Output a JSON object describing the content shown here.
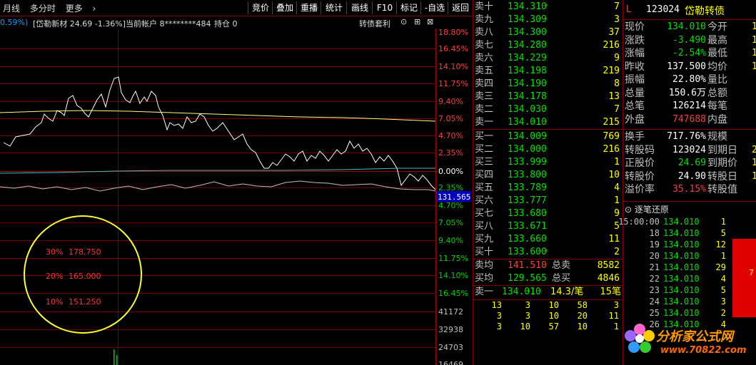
{
  "toolbar": {
    "left": [
      "月线",
      "多分时",
      "更多"
    ],
    "buttons": [
      "竞价",
      "叠加",
      "重播",
      "统计",
      "画线",
      "F10",
      "标记",
      "-自选",
      "返回"
    ]
  },
  "info": {
    "pct": "0.59%)",
    "stock": "[岱勒新材 24.69 -1.36%]",
    "account": "当前帐户 8********484",
    "position": "持仓 0",
    "arb": "转债套利"
  },
  "chart_data": {
    "type": "line",
    "y_axis_right_top": [
      "18.80%",
      "16.45%",
      "14.10%",
      "11.75%",
      "9.40%",
      "7.05%",
      "4.70%",
      "2.35%",
      "0.00%",
      "2.35%"
    ],
    "y_axis_right_bottom": [
      "4.70%",
      "7.05%",
      "9.40%",
      "11.75%",
      "14.10%",
      "16.45%"
    ],
    "current_price_label": "131.565",
    "volume_axis": [
      "41172",
      "32938",
      "24703",
      "16469"
    ],
    "annotations": [
      {
        "pct": "30%",
        "value": "178.750"
      },
      {
        "pct": "20%",
        "value": "165.000"
      },
      {
        "pct": "10%",
        "value": "151.250"
      }
    ]
  },
  "orderbook": {
    "asks": [
      {
        "label": "卖十",
        "price": "134.310",
        "mark": "*",
        "vol": "7"
      },
      {
        "label": "卖九",
        "price": "134.309",
        "mark": "",
        "vol": "3"
      },
      {
        "label": "卖八",
        "price": "134.300",
        "mark": "",
        "vol": "37"
      },
      {
        "label": "卖七",
        "price": "134.280",
        "mark": "",
        "vol": "216"
      },
      {
        "label": "卖六",
        "price": "134.229",
        "mark": "",
        "vol": "9"
      },
      {
        "label": "卖五",
        "price": "134.198",
        "mark": "",
        "vol": "219"
      },
      {
        "label": "卖四",
        "price": "134.190",
        "mark": "",
        "vol": "8"
      },
      {
        "label": "卖三",
        "price": "134.178",
        "mark": "",
        "vol": "13"
      },
      {
        "label": "卖二",
        "price": "134.030",
        "mark": "",
        "vol": "7"
      },
      {
        "label": "卖一",
        "price": "134.010",
        "mark": "",
        "vol": "215"
      }
    ],
    "bids": [
      {
        "label": "买一",
        "price": "134.009",
        "mark": "",
        "vol": "769"
      },
      {
        "label": "买二",
        "price": "134.000",
        "mark": "",
        "vol": "216"
      },
      {
        "label": "买三",
        "price": "133.999",
        "mark": "",
        "vol": "1"
      },
      {
        "label": "买四",
        "price": "133.800",
        "mark": "",
        "vol": "10"
      },
      {
        "label": "买五",
        "price": "133.789",
        "mark": "",
        "vol": "4"
      },
      {
        "label": "买六",
        "price": "133.777",
        "mark": "",
        "vol": "1"
      },
      {
        "label": "买七",
        "price": "133.680",
        "mark": "",
        "vol": "9"
      },
      {
        "label": "买八",
        "price": "133.671",
        "mark": "",
        "vol": "5"
      },
      {
        "label": "买九",
        "price": "133.660",
        "mark": "",
        "vol": "11"
      },
      {
        "label": "买十",
        "price": "133.600",
        "mark": "*",
        "vol": "2"
      }
    ],
    "summary": [
      {
        "l1": "卖均",
        "v1": "141.510",
        "l2": "总卖",
        "v2": "8582"
      },
      {
        "l1": "买均",
        "v1": "129.565",
        "l2": "总买",
        "v2": "4846"
      }
    ],
    "last": {
      "label": "卖一",
      "price": "134.010",
      "amt": "14.3/笔",
      "count": "15笔"
    },
    "ticks": [
      [
        "13",
        "3",
        "10",
        "58",
        "3"
      ],
      [
        "3",
        "3",
        "10",
        "20",
        "11"
      ],
      [
        "3",
        "10",
        "57",
        "10",
        "1"
      ]
    ]
  },
  "quote": {
    "flag": "L",
    "code": "123024",
    "name": "岱勒转债",
    "rows": [
      {
        "l": "现价",
        "v": "134.010",
        "c": "green",
        "l2": "今开",
        "v2": "1"
      },
      {
        "l": "涨跌",
        "v": "-3.490",
        "c": "green",
        "l2": "最高",
        "v2": "1"
      },
      {
        "l": "涨幅",
        "v": "-2.54%",
        "c": "green",
        "l2": "最低",
        "v2": "1"
      },
      {
        "l": "昨收",
        "v": "137.500",
        "c": "white",
        "l2": "均价",
        "v2": "1"
      },
      {
        "l": "振幅",
        "v": "22.80%",
        "c": "white",
        "l2": "量比",
        "v2": ""
      },
      {
        "l": "总量",
        "v": "150.6万",
        "c": "white",
        "l2": "总额",
        "v2": ""
      },
      {
        "l": "总笔",
        "v": "126214",
        "c": "white",
        "l2": "每笔",
        "v2": ""
      },
      {
        "l": "外盘",
        "v": "747688",
        "c": "red",
        "l2": "内盘",
        "v2": ""
      }
    ],
    "rows2": [
      {
        "l": "换手",
        "v": "717.76%",
        "c": "white",
        "l2": "规模",
        "v2": ""
      },
      {
        "l": "转股码",
        "v": "123024",
        "c": "white",
        "l2": "到期日",
        "v2": "2"
      },
      {
        "l": "正股价",
        "v": "24.69",
        "c": "green",
        "l2": "到期价",
        "v2": "1"
      },
      {
        "l": "转股价",
        "v": "24.90",
        "c": "white",
        "l2": "转股日",
        "v2": "1"
      },
      {
        "l": "溢价率",
        "v": "35.15%",
        "c": "red",
        "l2": "转股值",
        "v2": ""
      }
    ],
    "restore_title": "逐笔还原",
    "trades": [
      {
        "t": "15:00:00",
        "p": "134.010",
        "v": "1"
      },
      {
        "t": "18",
        "p": "134.010",
        "v": "5"
      },
      {
        "t": "19",
        "p": "134.010",
        "v": "12"
      },
      {
        "t": "20",
        "p": "134.010",
        "v": "1"
      },
      {
        "t": "21",
        "p": "134.010",
        "v": "29"
      },
      {
        "t": "22",
        "p": "134.010",
        "v": "4"
      },
      {
        "t": "23",
        "p": "134.010",
        "v": "5"
      },
      {
        "t": "24",
        "p": "134.010",
        "v": "3"
      },
      {
        "t": "25",
        "p": "134.010",
        "v": "2"
      },
      {
        "t": "26",
        "p": "134.010",
        "v": "4"
      }
    ],
    "bar_label": "7"
  },
  "watermark": {
    "title": "分析家公式网",
    "url": "www.70822.com"
  }
}
